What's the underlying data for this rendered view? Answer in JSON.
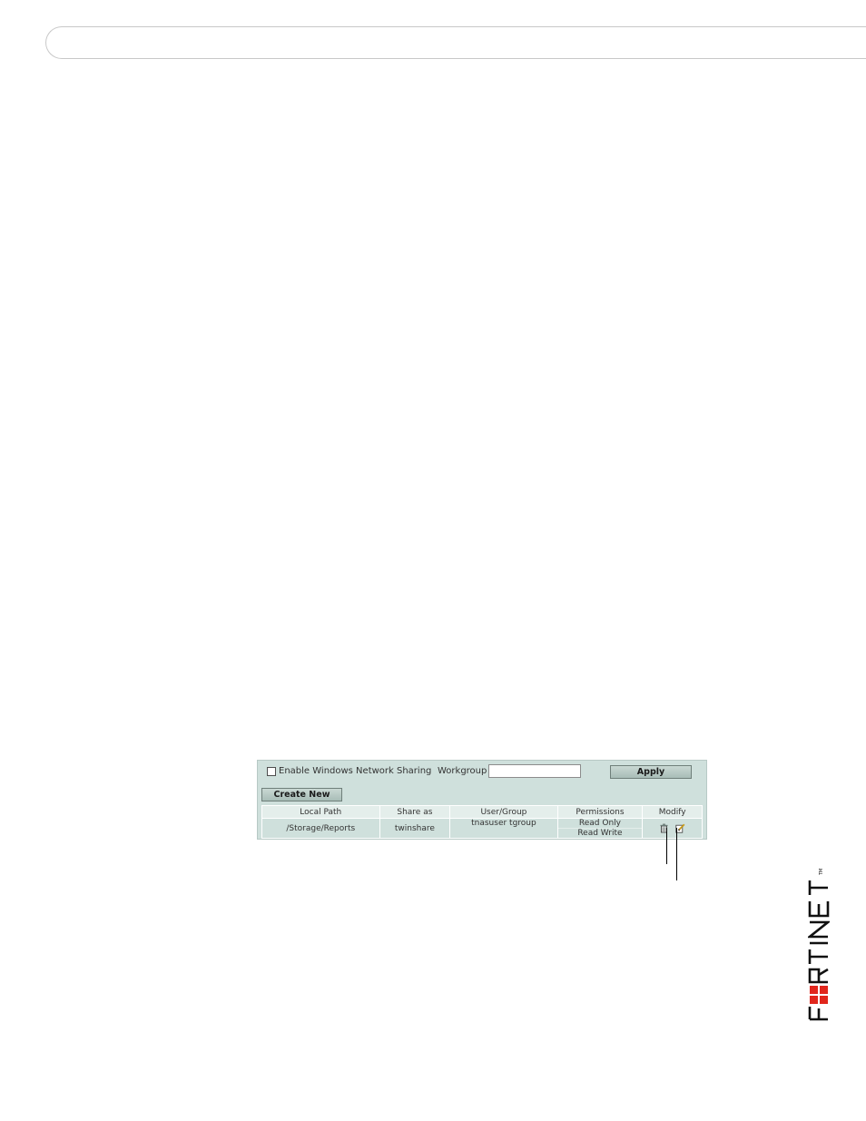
{
  "toolbar": {
    "enable_sharing_label": "Enable Windows Network Sharing",
    "enable_sharing_checked": false,
    "workgroup_label": "Workgroup",
    "workgroup_value": "",
    "apply_label": "Apply",
    "create_new_label": "Create New"
  },
  "table": {
    "headers": [
      "Local Path",
      "Share as",
      "User/Group",
      "Permissions",
      "Modify"
    ],
    "rows": [
      {
        "local_path": "/Storage/Reports",
        "share_as": "twinshare",
        "user_group": "tnasuser tgroup",
        "permissions": [
          "Read Only",
          "Read Write"
        ],
        "modify_icons": [
          "delete-icon",
          "edit-icon"
        ]
      }
    ]
  },
  "logo": {
    "brand_text": "FORTINET",
    "trademark": "TM",
    "accent_color": "#e1261c"
  }
}
